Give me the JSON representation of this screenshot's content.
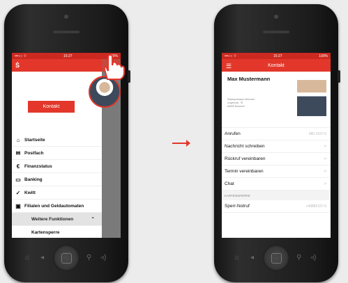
{
  "left_screen": {
    "status": {
      "carrier": "•••○○ ⌔",
      "time": "15:27",
      "battery": "100%"
    },
    "kontakt_button": "Kontakt",
    "menu": [
      {
        "icon": "home-icon",
        "glyph": "⌂",
        "label": "Startseite"
      },
      {
        "icon": "mail-icon",
        "glyph": "✉",
        "label": "Postfach"
      },
      {
        "icon": "euro-icon",
        "glyph": "€",
        "label": "Finanzstatus"
      },
      {
        "icon": "bank-card-icon",
        "glyph": "▭",
        "label": "Banking"
      },
      {
        "icon": "check-icon",
        "glyph": "✓",
        "label": "Kwitt"
      },
      {
        "icon": "atm-icon",
        "glyph": "▣",
        "label": "Filialen und Geldautomaten"
      }
    ],
    "more_functions": "Weitere Funktionen",
    "card_block": "Kartensperre"
  },
  "right_screen": {
    "status": {
      "carrier": "•••○○ ⌔",
      "time": "15:27",
      "battery": "100%"
    },
    "title": "Kontakt",
    "name": "Max Mustermann",
    "address_lines": [
      "Stadtsparkasse München",
      "Ungererstr. 75",
      "80805 München"
    ],
    "rows": [
      {
        "label": "Anrufen",
        "value": "089 2167-0"
      },
      {
        "label": "Nachricht schreiben",
        "value": ">"
      },
      {
        "label": "Rückruf vereinbaren",
        "value": ">"
      },
      {
        "label": "Termin vereinbaren",
        "value": ">"
      },
      {
        "label": "Chat",
        "value": ">"
      }
    ],
    "section_label": "KARTENSPERRE",
    "emergency": {
      "label": "Sperr-Notruf",
      "value": "+49882167-0"
    }
  }
}
